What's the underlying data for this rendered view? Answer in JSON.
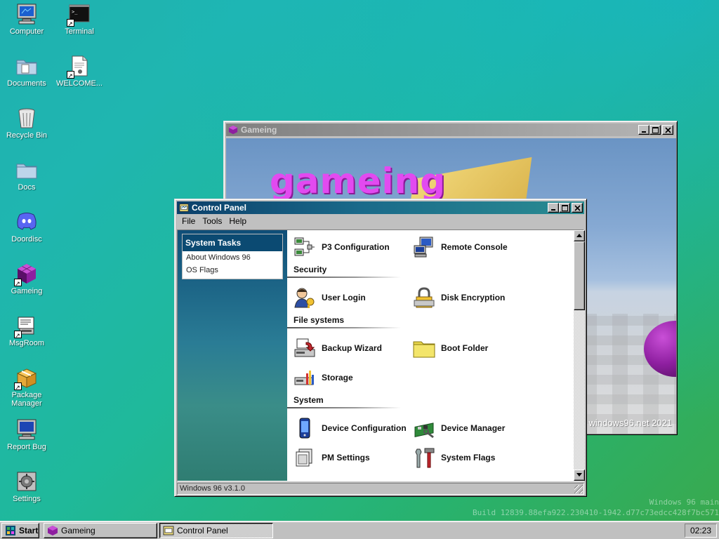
{
  "desktop": {
    "icons": [
      {
        "label": "Computer",
        "icon": "computer-icon"
      },
      {
        "label": "Terminal",
        "icon": "terminal-icon"
      },
      {
        "label": "Documents",
        "icon": "documents-folder-icon"
      },
      {
        "label": "WELCOME...",
        "icon": "text-document-icon"
      },
      {
        "label": "Recycle Bin",
        "icon": "recycle-bin-icon"
      },
      {
        "label": "Docs",
        "icon": "folder-icon"
      },
      {
        "label": "Doordisc",
        "icon": "doordisc-icon"
      },
      {
        "label": "Gameing",
        "icon": "gameing-cube-icon"
      },
      {
        "label": "MsgRoom",
        "icon": "msgroom-icon"
      },
      {
        "label": "Package Manager",
        "icon": "package-icon"
      },
      {
        "label": "Report Bug",
        "icon": "report-bug-icon"
      },
      {
        "label": "Settings",
        "icon": "settings-icon"
      }
    ]
  },
  "game_window": {
    "title": "Gameing",
    "heading": "gameing",
    "watermark": "windows96.net 2021"
  },
  "control_panel": {
    "title": "Control Panel",
    "menu": [
      "File",
      "Tools",
      "Help"
    ],
    "tasks": {
      "heading": "System Tasks",
      "items": [
        "About Windows 96",
        "OS Flags"
      ]
    },
    "items": {
      "p3_configuration": "P3 Configuration",
      "remote_console": "Remote Console",
      "user_login": "User Login",
      "disk_encryption": "Disk Encryption",
      "backup_wizard": "Backup Wizard",
      "boot_folder": "Boot Folder",
      "storage": "Storage",
      "device_configuration": "Device Configuration",
      "device_manager": "Device Manager",
      "pm_settings": "PM Settings",
      "system_flags": "System Flags"
    },
    "sections": {
      "security": "Security",
      "file_systems": "File systems",
      "system": "System"
    },
    "status": "Windows 96 v3.1.0"
  },
  "build_info": {
    "line1": "Windows 96 main",
    "line2": "Build 12839.88efa922.230410-1942.d77c73edcc428f7bc571"
  },
  "taskbar": {
    "start_label": "Start",
    "buttons": [
      {
        "label": "Gameing",
        "pressed": false
      },
      {
        "label": "Control Panel",
        "pressed": true
      }
    ],
    "clock": "02:23"
  },
  "colors": {
    "title_active": "#0b3f6a",
    "desktop_teal": "#1fb1b0",
    "desktop_green": "#3aa94c",
    "game_text": "#e24af0"
  }
}
